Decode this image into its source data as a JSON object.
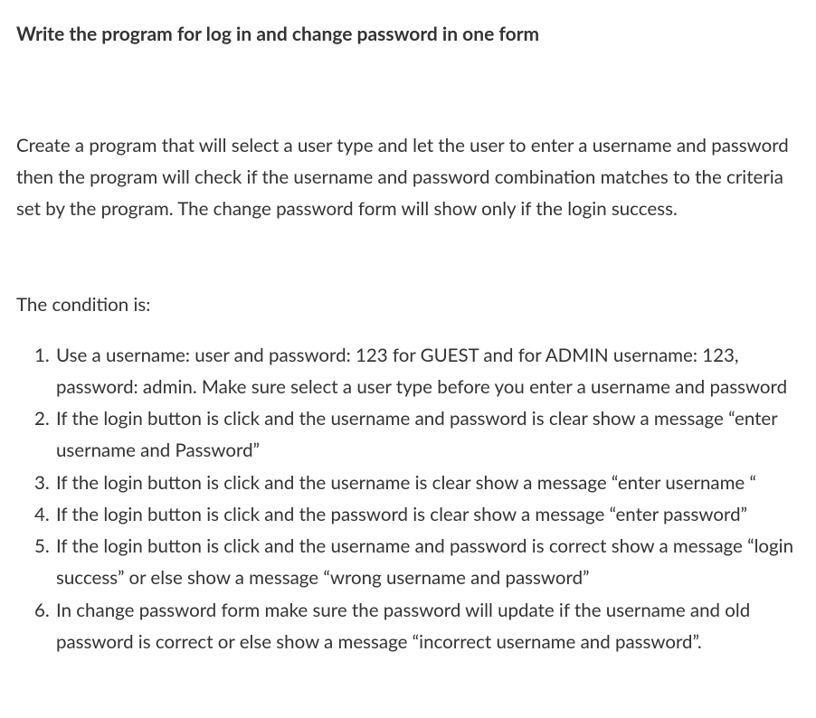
{
  "title": "Write the program for log in and change password in one form",
  "intro": "Create a program that will select a user type and let the user to enter a username and password then the program will check if the username and password combination matches to the criteria set by the program. The change password form will show only if the login success.",
  "condition_label": "The condition is:",
  "conditions": [
    "Use a username: user and password: 123 for GUEST and for ADMIN username: 123, password: admin. Make sure select a user type before you enter a username and password",
    "If the login button is click and the username and password is clear show a message “enter username and Password”",
    "If the login button is click and the username is clear show a message “enter username “",
    "If the login button is click and the password is clear show a message “enter password”",
    "If the login button is click and the username and password is correct show a message “login success” or else show a message “wrong username and password”",
    "In change password form make sure the password will update if the username and old password is correct or else show a message “incorrect username and password”."
  ]
}
